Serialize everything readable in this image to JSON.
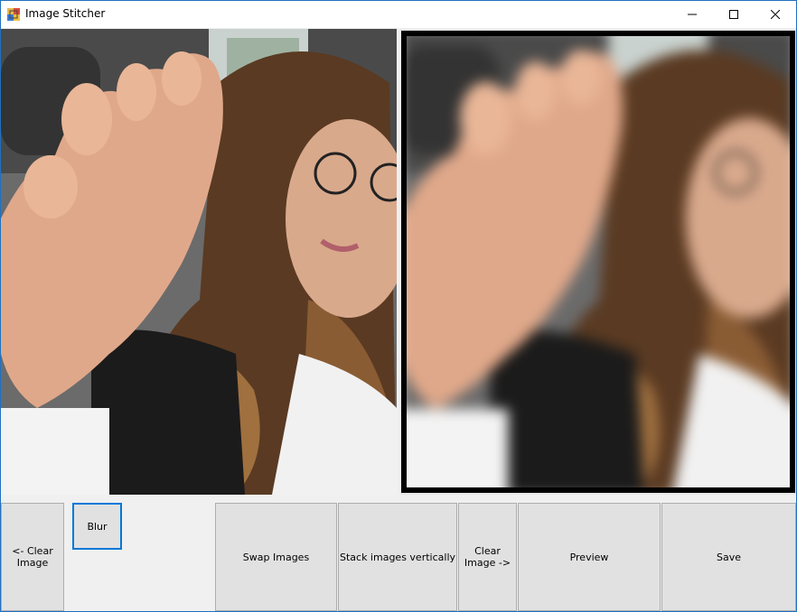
{
  "window": {
    "title": "Image Stitcher",
    "accent_color": "#1f70c1",
    "controls": {
      "minimize": "minimize-icon",
      "maximize": "maximize-icon",
      "close": "close-icon"
    }
  },
  "images": {
    "left": {
      "state": "loaded"
    },
    "right": {
      "state": "loaded-blurred",
      "frame_color": "#000000"
    }
  },
  "buttons": {
    "clear_left": "<- Clear\nImage",
    "blur": "Blur",
    "swap": "Swap Images",
    "stack": "Stack images vertically",
    "clear_right": "Clear\nImage ->",
    "preview": "Preview",
    "save": "Save"
  }
}
